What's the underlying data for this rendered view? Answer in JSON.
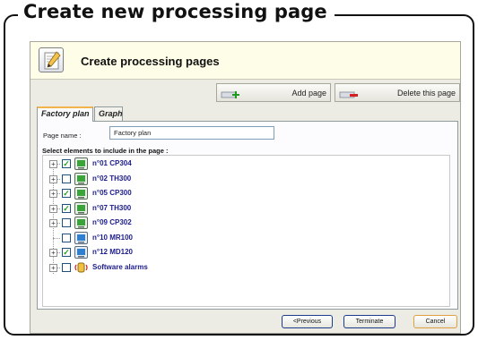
{
  "frame": {
    "title": "Create new processing page"
  },
  "dialog": {
    "header_title": "Create processing pages",
    "toolbar": {
      "add_label": "Add page",
      "delete_label": "Delete this page"
    },
    "tabs": [
      {
        "label": "Factory plan",
        "active": true
      },
      {
        "label": "Graph",
        "active": false
      }
    ],
    "page_name": {
      "label": "Page name :",
      "value": "Factory plan"
    },
    "select_label": "Select elements to include in the page :",
    "tree_items": [
      {
        "label": "n°01 CP304",
        "checked": true,
        "expandable": true,
        "icon": "green-device-icon"
      },
      {
        "label": "n°02 TH300",
        "checked": false,
        "expandable": true,
        "icon": "green-device-icon"
      },
      {
        "label": "n°05 CP300",
        "checked": true,
        "expandable": true,
        "icon": "green-device-icon"
      },
      {
        "label": "n°07 TH300",
        "checked": true,
        "expandable": true,
        "icon": "green-device-icon"
      },
      {
        "label": "n°09 CP302",
        "checked": false,
        "expandable": true,
        "icon": "green-device-icon"
      },
      {
        "label": "n°10 MR100",
        "checked": false,
        "expandable": false,
        "icon": "blue-device-icon"
      },
      {
        "label": "n°12 MD120",
        "checked": true,
        "expandable": true,
        "icon": "blue-device-icon"
      },
      {
        "label": "Software alarms",
        "checked": false,
        "expandable": true,
        "icon": "speaker-alarm-icon"
      }
    ],
    "footer": {
      "previous_label": "<Previous",
      "terminate_label": "Terminate",
      "cancel_label": "Cancel"
    }
  },
  "colors": {
    "header_bg": "#fefee8",
    "dialog_bg": "#ecebe4",
    "item_text": "#1c1c8c",
    "check": "#21a121",
    "tab_accent": "#f0b44a"
  }
}
